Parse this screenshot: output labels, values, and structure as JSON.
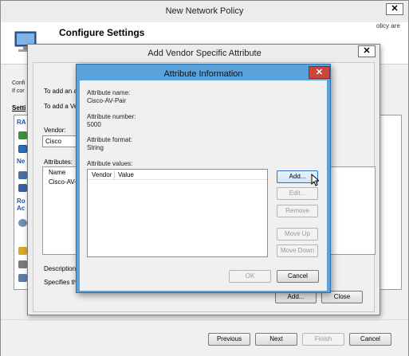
{
  "outer": {
    "title": "New Network Policy",
    "close_glyph": "✕",
    "heading": "Configure Settings",
    "header_right_fragment": "olicy are",
    "left_fragment_1": "Confi",
    "left_fragment_2": "If cor",
    "settings_label": "Setti",
    "tree": {
      "caption_1": "RA",
      "caption_2": "Ne",
      "caption_3": "Ro",
      "caption_4": "Ac"
    },
    "buttons": {
      "previous": "Previous",
      "next": "Next",
      "finish": "Finish",
      "cancel": "Cancel"
    }
  },
  "mid": {
    "title": "Add Vendor Specific Attribute",
    "close_glyph": "✕",
    "to_add_1": "To add an attı",
    "to_add_2": "To add a Vend",
    "vendor_label": "Vendor:",
    "vendor_value": "Cisco",
    "attributes_label": "Attributes:",
    "attr_col_name": "Name",
    "attr_row_1": "Cisco-AV-Pa",
    "description_label": "Description:",
    "description_text": "Specifies the C",
    "add_button": "Add...",
    "close_button": "Close"
  },
  "dialog": {
    "title": "Attribute Information",
    "close_glyph": "✕",
    "attribute_name_label": "Attribute name:",
    "attribute_name_value": "Cisco-AV-Pair",
    "attribute_number_label": "Attribute number:",
    "attribute_number_value": "5000",
    "attribute_format_label": "Attribute format:",
    "attribute_format_value": "String",
    "attribute_values_label": "Attribute values:",
    "columns": {
      "vendor": "Vendor",
      "value": "Value"
    },
    "buttons": {
      "add": "Add...",
      "edit": "Edit...",
      "remove": "Remove",
      "move_up": "Move Up",
      "move_down": "Move Down",
      "ok": "OK",
      "cancel": "Cancel"
    }
  },
  "colors": {
    "dialog_frame": "#5aa2dc",
    "close_red": "#c9463d",
    "link_blue": "#1a57a8"
  }
}
